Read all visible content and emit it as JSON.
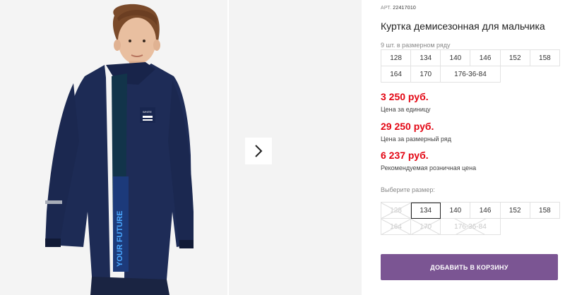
{
  "product": {
    "article_label": "АРТ.",
    "article": "22417010",
    "title": "Куртка демисезонная для мальчика"
  },
  "gallery": {
    "jacket_lettering": "YOUR FUTURE",
    "jacket_badge": "WHITE"
  },
  "row_info": "9 шт. в размерном ряду",
  "row_sizes": [
    "128",
    "134",
    "140",
    "146",
    "152",
    "158",
    "164",
    "170",
    "176-36-84"
  ],
  "prices": [
    {
      "amount": "3 250 руб.",
      "label": "Цена за единицу"
    },
    {
      "amount": "29 250 руб.",
      "label": "Цена за размерный ряд"
    },
    {
      "amount": "6 237 руб.",
      "label": "Рекомендуемая розничная цена"
    }
  ],
  "size_picker": {
    "label": "Выберите размер:",
    "options": [
      {
        "label": "128",
        "available": false
      },
      {
        "label": "134",
        "available": true,
        "selected": true
      },
      {
        "label": "140",
        "available": true
      },
      {
        "label": "146",
        "available": true
      },
      {
        "label": "152",
        "available": true
      },
      {
        "label": "158",
        "available": true
      },
      {
        "label": "164",
        "available": false
      },
      {
        "label": "170",
        "available": false
      },
      {
        "label": "176-36-84",
        "available": false
      }
    ]
  },
  "cart_button": "ДОБАВИТЬ В КОРЗИНУ",
  "colors": {
    "price": "#e30613",
    "cart_button": "#7b5593",
    "jacket": "#1d2b55"
  }
}
